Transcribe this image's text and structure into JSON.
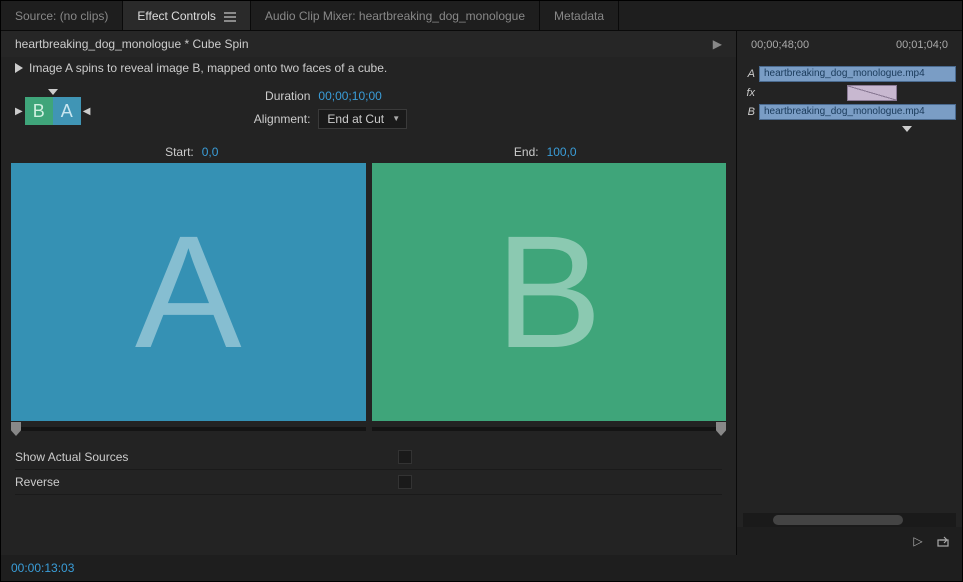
{
  "tabs": {
    "source": "Source: (no clips)",
    "effect_controls": "Effect Controls",
    "audio_mixer": "Audio Clip Mixer: heartbreaking_dog_monologue",
    "metadata": "Metadata"
  },
  "title": "heartbreaking_dog_monologue * Cube Spin",
  "description": "Image A spins to reveal image B, mapped onto two faces of a cube.",
  "ba_preview": {
    "b": "B",
    "a": "A"
  },
  "fields": {
    "duration_label": "Duration",
    "duration_value": "00;00;10;00",
    "alignment_label": "Alignment:",
    "alignment_value": "End at Cut"
  },
  "preview": {
    "start_label": "Start:",
    "start_value": "0,0",
    "end_label": "End:",
    "end_value": "100,0",
    "letter_a": "A",
    "letter_b": "B"
  },
  "options": {
    "show_actual": "Show Actual Sources",
    "reverse": "Reverse"
  },
  "footer": {
    "timecode": "00:00:13:03"
  },
  "timeline": {
    "time_left": "00;00;48;00",
    "time_right": "00;01;04;0",
    "track_a_label": "A",
    "track_fx_label": "fx",
    "track_b_label": "B",
    "clip_name": "heartbreaking_dog_monologue.mp4"
  }
}
